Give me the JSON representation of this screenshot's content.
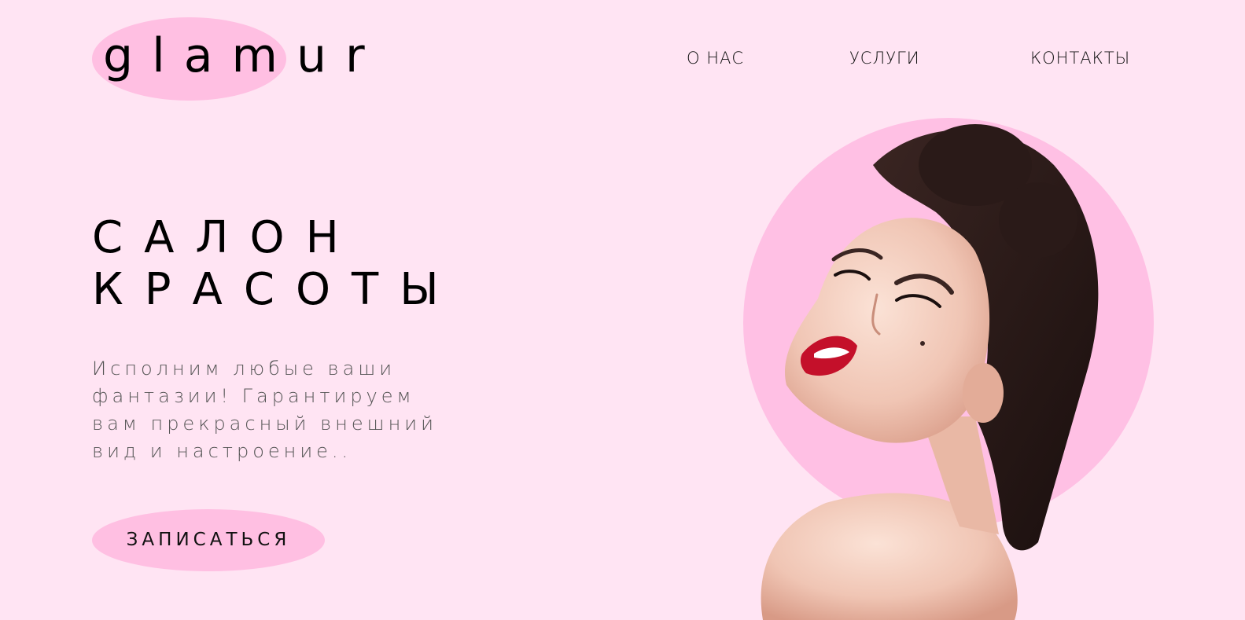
{
  "brand": {
    "logo_text": "glamur"
  },
  "nav": {
    "items": [
      {
        "label": "О НАС"
      },
      {
        "label": "УСЛУГИ"
      },
      {
        "label": "КОНТАКТЫ"
      }
    ]
  },
  "hero": {
    "title_line1": "САЛОН",
    "title_line2": "КРАСОТЫ",
    "description": "Исполним любые ваши фантазии! Гарантируем вам прекрасный внешний вид и настроение..",
    "cta_label": "ЗАПИСАТЬСЯ"
  },
  "colors": {
    "background": "#ffe4f3",
    "accent_pink": "#ffbfe2",
    "text": "#111111"
  }
}
